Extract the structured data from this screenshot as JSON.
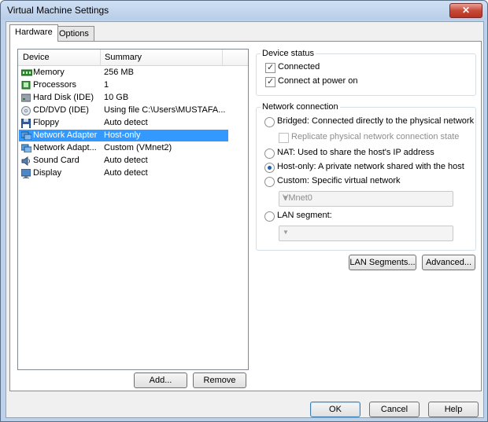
{
  "window": {
    "title": "Virtual Machine Settings",
    "close_glyph": "✕"
  },
  "tabs": [
    {
      "label": "Hardware"
    },
    {
      "label": "Options"
    }
  ],
  "device_list": {
    "columns": [
      "Device",
      "Summary"
    ],
    "rows": [
      {
        "device": "Memory",
        "summary": "256 MB",
        "icon": "memory-icon"
      },
      {
        "device": "Processors",
        "summary": "1",
        "icon": "processor-icon"
      },
      {
        "device": "Hard Disk (IDE)",
        "summary": "10 GB",
        "icon": "hard-disk-icon"
      },
      {
        "device": "CD/DVD (IDE)",
        "summary": "Using file C:\\Users\\MUSTAFA...",
        "icon": "cd-dvd-icon"
      },
      {
        "device": "Floppy",
        "summary": "Auto detect",
        "icon": "floppy-icon"
      },
      {
        "device": "Network Adapter",
        "summary": "Host-only",
        "icon": "network-adapter-icon",
        "selected": true
      },
      {
        "device": "Network Adapt...",
        "summary": "Custom (VMnet2)",
        "icon": "network-adapter-icon"
      },
      {
        "device": "Sound Card",
        "summary": "Auto detect",
        "icon": "sound-card-icon"
      },
      {
        "device": "Display",
        "summary": "Auto detect",
        "icon": "display-icon"
      }
    ],
    "add_label": "Add...",
    "remove_label": "Remove"
  },
  "device_status": {
    "title": "Device status",
    "connected": {
      "label": "Connected",
      "checked": true
    },
    "connect_at_power_on": {
      "label": "Connect at power on",
      "checked": true
    }
  },
  "network_connection": {
    "title": "Network connection",
    "bridged": {
      "label": "Bridged: Connected directly to the physical network",
      "selected": false
    },
    "replicate": {
      "label": "Replicate physical network connection state",
      "checked": false,
      "disabled": true
    },
    "nat": {
      "label": "NAT: Used to share the host's IP address",
      "selected": false
    },
    "host_only": {
      "label": "Host-only: A private network shared with the host",
      "selected": true
    },
    "custom": {
      "label": "Custom: Specific virtual network",
      "selected": false
    },
    "custom_select": {
      "value": "VMnet0"
    },
    "lan_segment": {
      "label": "LAN segment:",
      "selected": false
    },
    "lan_select": {
      "value": ""
    },
    "lan_segments_button": "LAN Segments...",
    "advanced_button": "Advanced..."
  },
  "footer": {
    "ok": "OK",
    "cancel": "Cancel",
    "help": "Help"
  }
}
